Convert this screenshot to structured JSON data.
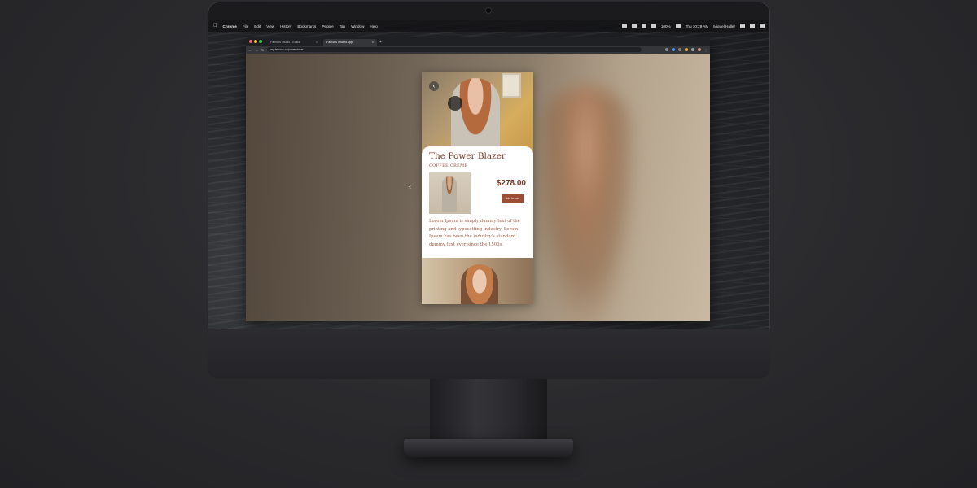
{
  "menubar": {
    "app": "Chrome",
    "menus": [
      "File",
      "Edit",
      "View",
      "History",
      "Bookmarks",
      "People",
      "Tab",
      "Window",
      "Help"
    ],
    "battery": "100%",
    "clock": "Thu 10:29 AM",
    "user": "Miguel Haller"
  },
  "browser": {
    "tabs": [
      {
        "label": "Famous Studio - Editor"
      },
      {
        "label": "Famous Instant App"
      }
    ],
    "url": "my.famous.co/powerblazer1"
  },
  "product": {
    "title": "The Power Blazer",
    "color": "COFFEE CREME",
    "price": "$278.00",
    "cta": "Add to cart",
    "description": "Lorem Ipsum is simply dummy text of the printing and typesetting industry. Lorem Ipsum has been the industry's standard dummy text ever since the 1500s."
  },
  "icons": {
    "back": "chevron-left-icon",
    "nav": "chevron-left-icon",
    "apple": "apple-icon"
  },
  "colors": {
    "accent": "#9b4e33",
    "title": "#7a3b2a",
    "text": "#a35a42"
  }
}
